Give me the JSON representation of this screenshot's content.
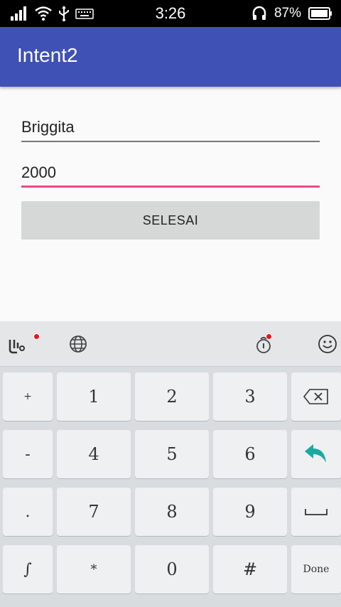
{
  "status_bar": {
    "time": "3:26",
    "battery_percent": "87%",
    "icons": [
      "signal-icon",
      "wifi-icon",
      "usb-icon",
      "keyboard-icon",
      "headphones-icon",
      "battery-icon"
    ]
  },
  "app_bar": {
    "title": "Intent2",
    "color": "#3f51b5"
  },
  "form": {
    "name_value": "Briggita",
    "amount_value": "2000",
    "submit_label": "SELESAI",
    "focus_color": "#e84c8a"
  },
  "keyboard": {
    "toolbar_icons": [
      "touchpal-logo-icon",
      "globe-icon",
      "theme-icon",
      "emoji-icon"
    ],
    "rows": [
      {
        "side": "+",
        "keys": [
          "1",
          "2",
          "3"
        ],
        "action": "backspace-icon"
      },
      {
        "side": "-",
        "keys": [
          "4",
          "5",
          "6"
        ],
        "action": "enter-arrow-icon"
      },
      {
        "side": ".",
        "keys": [
          "7",
          "8",
          "9"
        ],
        "action": "space-icon"
      },
      {
        "side": "∫",
        "keys": [
          "*",
          "0",
          "#"
        ],
        "action_label": "Done"
      }
    ]
  }
}
